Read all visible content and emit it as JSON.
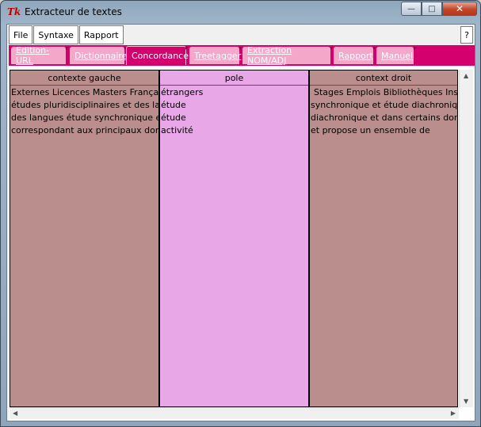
{
  "window": {
    "title": "Extracteur de textes",
    "icon": "Tk",
    "controls": {
      "minimize": "—",
      "maximize": "□",
      "close": "✕"
    }
  },
  "menubar": {
    "items": [
      {
        "label": "File"
      },
      {
        "label": "Syntaxe"
      },
      {
        "label": "Rapport"
      }
    ],
    "help": "?"
  },
  "tabs": [
    {
      "label": "Edition-URL",
      "active": false
    },
    {
      "label": "Dictionnaire",
      "active": false
    },
    {
      "label": "Concordance",
      "active": true
    },
    {
      "label": "Treetagger",
      "active": false
    },
    {
      "label": "Extraction NOM/ADJ",
      "active": false
    },
    {
      "label": "Rapport",
      "active": false
    },
    {
      "label": "Manuel",
      "active": false
    }
  ],
  "concordance": {
    "headers": {
      "gauche": "contexte gauche",
      "pole": "pole",
      "droit": "context droit"
    },
    "gauche": [
      "Externes Licences Masters Français pour",
      "études pluridisciplinaires et des langues",
      "des langues étude synchronique et",
      "correspondant aux principaux domaines"
    ],
    "pole": [
      "étrangers",
      "étude",
      "étude",
      "activité"
    ],
    "droit": [
      "Stages Emplois Bibliothèques Institut",
      "synchronique et étude diachronique et",
      "diachronique et dans certains domaines",
      "et propose un ensemble de"
    ]
  },
  "colors": {
    "tabbar": "#d4006e",
    "tab_inactive": "#f4a7c9",
    "context_column": "#bb8e8e",
    "pole_column": "#e8a8e8"
  }
}
